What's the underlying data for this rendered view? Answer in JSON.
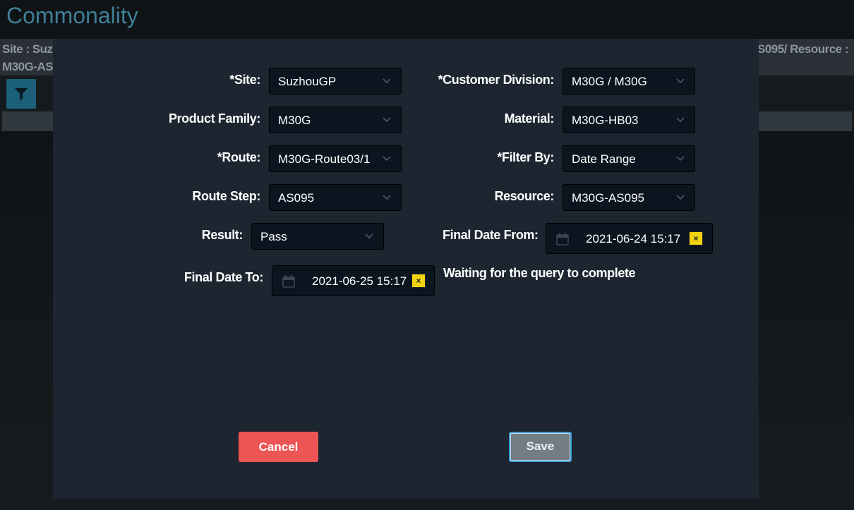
{
  "app": {
    "title": "Commonality"
  },
  "background": {
    "info_line1": "Site : Suz",
    "info_line2": "M30G-AS",
    "info_right": "S095/ Resource :",
    "filter_icon": "filter-icon"
  },
  "form": {
    "site": {
      "label": "*Site:",
      "value": "SuzhouGP"
    },
    "customer_division": {
      "label": "*Customer Division:",
      "value": "M30G / M30G"
    },
    "product_family": {
      "label": "Product Family:",
      "value": "M30G"
    },
    "material": {
      "label": "Material:",
      "value": "M30G-HB03"
    },
    "route": {
      "label": "*Route:",
      "value": "M30G-Route03/1"
    },
    "filter_by": {
      "label": "*Filter By:",
      "value": "Date Range"
    },
    "route_step": {
      "label": "Route Step:",
      "value": "AS095"
    },
    "resource": {
      "label": "Resource:",
      "value": "M30G-AS095"
    },
    "result": {
      "label": "Result:",
      "value": "Pass"
    },
    "final_date_from": {
      "label": "Final Date From:",
      "value": "2021-06-24 15:17",
      "clear": "×"
    },
    "final_date_to": {
      "label": "Final Date To:",
      "value": "2021-06-25 15:17",
      "clear": "×"
    }
  },
  "status": "Waiting for the query to complete",
  "buttons": {
    "cancel": "Cancel",
    "save": "Save"
  },
  "colors": {
    "cancel": "#ed5454",
    "save": "#727d86",
    "accent": "#3aa0d8",
    "clear": "#f2d310"
  }
}
